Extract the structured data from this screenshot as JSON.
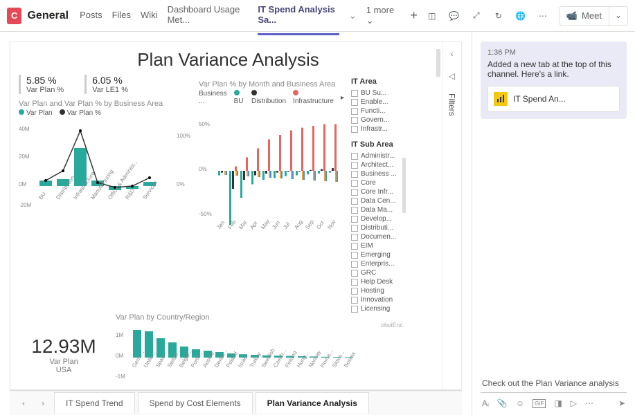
{
  "header": {
    "team_initial": "C",
    "channel": "General",
    "tabs": [
      "Posts",
      "Files",
      "Wiki",
      "Dashboard Usage Met...",
      "IT Spend Analysis Sa..."
    ],
    "active_tab_index": 4,
    "more_label": "1 more",
    "meet_label": "Meet"
  },
  "report": {
    "title": "Plan Variance Analysis",
    "kpi1": {
      "value": "5.85 %",
      "label": "Var Plan %"
    },
    "kpi2": {
      "value": "6.05 %",
      "label": "Var LE1 %"
    },
    "chart1": {
      "title": "Var Plan and Var Plan % by Business Area",
      "legend": [
        "Var Plan",
        "Var Plan %"
      ]
    },
    "chart2": {
      "title": "Var Plan % by Month and Business Area",
      "legend_label": "Business ...",
      "legend": [
        "BU",
        "Distribution",
        "Infrastructure"
      ]
    },
    "chart3": {
      "title": "Var Plan by Country/Region"
    },
    "big": {
      "value": "12.93M",
      "label1": "Var Plan",
      "label2": "USA"
    },
    "slicer1": {
      "title": "IT Area",
      "items": [
        "BU Su...",
        "Enable...",
        "Functi...",
        "Govern...",
        "Infrastr..."
      ]
    },
    "slicer2": {
      "title": "IT Sub Area",
      "items": [
        "Administr...",
        "Architect...",
        "Business ...",
        "Core",
        "Core Infr...",
        "Data Cen...",
        "Data Ma...",
        "Develop...",
        "Distributi...",
        "Documen...",
        "EIM",
        "Emerging",
        "Enterpris...",
        "GRC",
        "Help Desk",
        "Hosting",
        "Innovation",
        "Licensing"
      ]
    },
    "footer_text": "obviEnc",
    "filters_label": "Filters",
    "page_tabs": [
      "IT Spend Trend",
      "Spend by Cost Elements",
      "Plan Variance Analysis"
    ],
    "active_page_index": 2
  },
  "chat": {
    "time": "1:36 PM",
    "message": "Added a new tab at the top of this channel. Here's a link.",
    "link_label": "IT Spend An...",
    "compose_value": "Check out the Plan Variance analysis"
  },
  "chart_data": [
    {
      "type": "bar",
      "title": "Var Plan and Var Plan % by Business Area",
      "categories": [
        "BU",
        "Distribution",
        "Infrastructure",
        "Manufacturing",
        "Office & Administ...",
        "R&D",
        "Services"
      ],
      "series": [
        {
          "name": "Var Plan",
          "values": [
            3,
            4,
            24,
            3,
            -2,
            -1,
            2
          ]
        },
        {
          "name": "Var Plan %",
          "values": [
            10,
            30,
            120,
            5,
            -5,
            0,
            20
          ]
        }
      ],
      "ylim_left": [
        -20,
        40
      ],
      "ylim_right": [
        0,
        100
      ],
      "ylabel_left": "M",
      "ylabel_right": "%"
    },
    {
      "type": "bar",
      "title": "Var Plan % by Month and Business Area",
      "categories": [
        "Jan",
        "Feb",
        "Mar",
        "Apr",
        "May",
        "Jun",
        "Jul",
        "Aug",
        "Sep",
        "Oct",
        "Nov"
      ],
      "series": [
        {
          "name": "BU",
          "values": [
            -5,
            -60,
            -30,
            -15,
            -10,
            -8,
            -6,
            -5,
            -4,
            -3,
            -2
          ]
        },
        {
          "name": "Distribution",
          "values": [
            -2,
            -20,
            -10,
            -5,
            -3,
            -2,
            -1,
            0,
            1,
            2,
            3
          ]
        },
        {
          "name": "Infrastructure",
          "values": [
            0,
            5,
            15,
            25,
            35,
            40,
            45,
            48,
            50,
            52,
            52
          ]
        }
      ],
      "ylim": [
        -50,
        50
      ],
      "ylabel": "%"
    },
    {
      "type": "bar",
      "title": "Var Plan by Country/Region",
      "categories": [
        "Germ...",
        "Unite...",
        "Spain",
        "Switze...",
        "Belgiu...",
        "Portu...",
        "Austria",
        "Denm...",
        "Poland",
        "Israel",
        "Turkey",
        "Swedish",
        "Czech...",
        "Finland",
        "Hung...",
        "Norway",
        "Roma...",
        "Slova...",
        "Bosnia"
      ],
      "values": [
        1.0,
        0.95,
        0.7,
        0.55,
        0.4,
        0.3,
        0.25,
        0.2,
        0.15,
        0.12,
        0.1,
        0.08,
        0.07,
        0.06,
        0.05,
        0.04,
        0.03,
        0.02,
        0.01
      ],
      "ylim": [
        -1,
        1
      ],
      "ylabel": "M"
    }
  ]
}
